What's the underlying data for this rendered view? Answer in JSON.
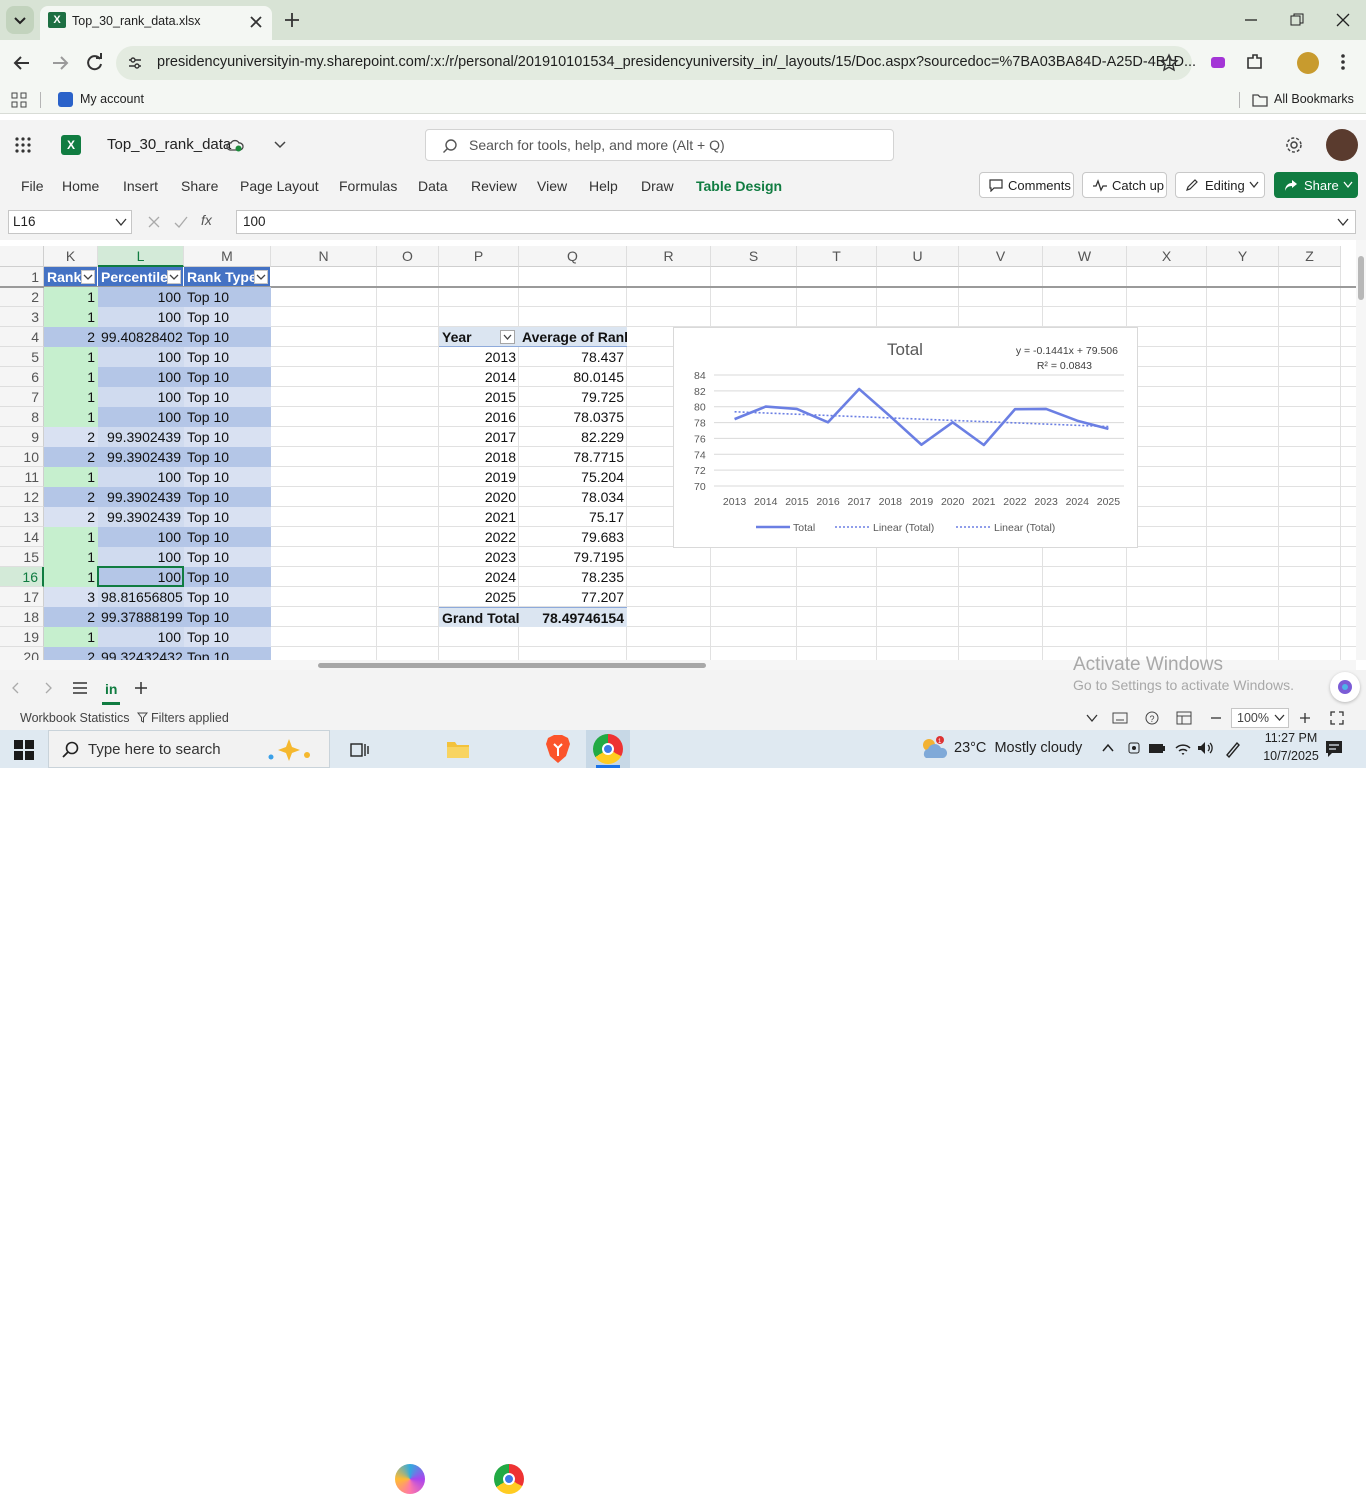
{
  "browser": {
    "tab_title": "Top_30_rank_data.xlsx",
    "url": "presidencyuniversityin-my.sharepoint.com/:x:/r/personal/201910101534_presidencyuniversity_in/_layouts/15/Doc.aspx?sourcedoc=%7BA03BA84D-A25D-4B1D...",
    "bookmark_account": "My account",
    "bookmarks_all": "All Bookmarks"
  },
  "excel": {
    "filename": "Top_30_rank_data",
    "search_placeholder": "Search for tools, help, and more (Alt + Q)",
    "menu": [
      "File",
      "Home",
      "Insert",
      "Share",
      "Page Layout",
      "Formulas",
      "Data",
      "Review",
      "View",
      "Help",
      "Draw",
      "Table Design"
    ],
    "buttons": {
      "comments": "Comments",
      "catchup": "Catch up",
      "editing": "Editing",
      "share": "Share"
    },
    "namebox": "L16",
    "formula_value": "100",
    "fx": "fx"
  },
  "grid": {
    "columns": [
      "K",
      "L",
      "M",
      "N",
      "O",
      "P",
      "Q",
      "R",
      "S",
      "T",
      "U",
      "V",
      "W",
      "X",
      "Y",
      "Z"
    ],
    "rows": [
      "1",
      "2",
      "3",
      "4",
      "5",
      "6",
      "7",
      "8",
      "9",
      "10",
      "11",
      "12",
      "13",
      "14",
      "15",
      "16",
      "17",
      "18",
      "19",
      "20"
    ],
    "table_headers": [
      "Rank",
      "Percentile",
      "Rank Type"
    ],
    "table_rows": [
      [
        "1",
        "100",
        "Top 10"
      ],
      [
        "1",
        "100",
        "Top 10"
      ],
      [
        "2",
        "99.40828402",
        "Top 10"
      ],
      [
        "1",
        "100",
        "Top 10"
      ],
      [
        "1",
        "100",
        "Top 10"
      ],
      [
        "1",
        "100",
        "Top 10"
      ],
      [
        "1",
        "100",
        "Top 10"
      ],
      [
        "2",
        "99.3902439",
        "Top 10"
      ],
      [
        "2",
        "99.3902439",
        "Top 10"
      ],
      [
        "1",
        "100",
        "Top 10"
      ],
      [
        "2",
        "99.3902439",
        "Top 10"
      ],
      [
        "2",
        "99.3902439",
        "Top 10"
      ],
      [
        "1",
        "100",
        "Top 10"
      ],
      [
        "1",
        "100",
        "Top 10"
      ],
      [
        "1",
        "100",
        "Top 10"
      ],
      [
        "3",
        "98.81656805",
        "Top 10"
      ],
      [
        "2",
        "99.37888199",
        "Top 10"
      ],
      [
        "1",
        "100",
        "Top 10"
      ],
      [
        "2",
        "99.32432432",
        "Top 10"
      ]
    ],
    "pivot_headers": [
      "Year",
      "Average of Rank"
    ],
    "pivot_rows": [
      [
        "2013",
        "78.437"
      ],
      [
        "2014",
        "80.0145"
      ],
      [
        "2015",
        "79.725"
      ],
      [
        "2016",
        "78.0375"
      ],
      [
        "2017",
        "82.229"
      ],
      [
        "2018",
        "78.7715"
      ],
      [
        "2019",
        "75.204"
      ],
      [
        "2020",
        "78.034"
      ],
      [
        "2021",
        "75.17"
      ],
      [
        "2022",
        "79.683"
      ],
      [
        "2023",
        "79.7195"
      ],
      [
        "2024",
        "78.235"
      ],
      [
        "2025",
        "77.207"
      ]
    ],
    "grand_total_label": "Grand Total",
    "grand_total_value": "78.49746154"
  },
  "chart_data": {
    "type": "line",
    "title": "Total",
    "categories": [
      "2013",
      "2014",
      "2015",
      "2016",
      "2017",
      "2018",
      "2019",
      "2020",
      "2021",
      "2022",
      "2023",
      "2024",
      "2025"
    ],
    "series": [
      {
        "name": "Total",
        "values": [
          78.437,
          80.0145,
          79.725,
          78.0375,
          82.229,
          78.7715,
          75.204,
          78.034,
          75.17,
          79.683,
          79.7195,
          78.235,
          77.207
        ]
      }
    ],
    "trendline": {
      "equation": "y = -0.1441x + 79.506",
      "r2": "R² = 0.0843",
      "slope": -0.1441,
      "intercept": 79.506
    },
    "legend": [
      "Total",
      "Linear (Total)",
      "Linear (Total)"
    ],
    "yticks": [
      "84",
      "82",
      "80",
      "78",
      "76",
      "74",
      "72",
      "70"
    ],
    "ylim": [
      70,
      84
    ],
    "grid": true,
    "legend_position": "bottom",
    "color": "#6b7fe3"
  },
  "sheet": {
    "tab": "in",
    "status_left": "Workbook Statistics",
    "filters": "Filters applied",
    "zoom": "100%"
  },
  "watermark": {
    "line1": "Activate Windows",
    "line2": "Go to Settings to activate Windows."
  },
  "taskbar": {
    "search": "Type here to search",
    "weather": "23°C  Mostly cloudy",
    "time": "11:27 PM",
    "date": "10/7/2025"
  }
}
